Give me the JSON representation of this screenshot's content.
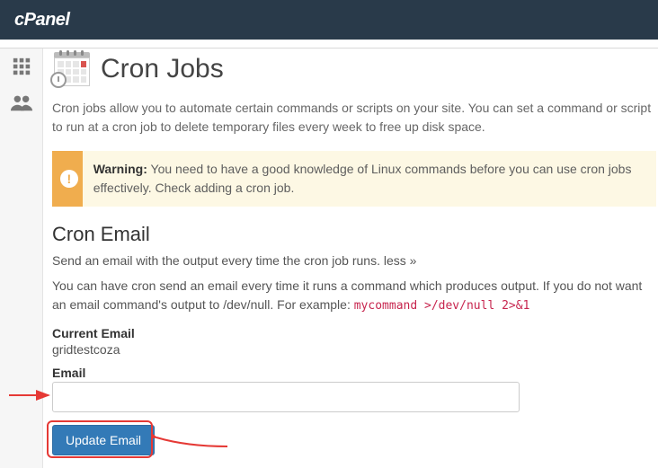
{
  "header": {
    "brand": "cPanel"
  },
  "page": {
    "title": "Cron Jobs",
    "intro": "Cron jobs allow you to automate certain commands or scripts on your site. You can set a command or script to run at a cron job to delete temporary files every week to free up disk space."
  },
  "alert": {
    "prefix": "Warning:",
    "text": " You need to have a good knowledge of Linux commands before you can use cron jobs effectively. Check adding a cron job."
  },
  "cron_email": {
    "title": "Cron Email",
    "desc": "Send an email with the output every time the cron job runs. less »",
    "desc2_before": "You can have cron send an email every time it runs a command which produces output. If you do not want an email command's output to /dev/null. For example: ",
    "code": "mycommand >/dev/null 2>&1",
    "current_email_label": "Current Email",
    "current_email_value": "gridtestcoza",
    "email_label": "Email",
    "email_value": "",
    "update_button": "Update Email"
  },
  "colors": {
    "topbar": "#293a4a",
    "primary_btn": "#337ab7",
    "warning": "#f0ad4e",
    "annotation": "#e53935"
  }
}
